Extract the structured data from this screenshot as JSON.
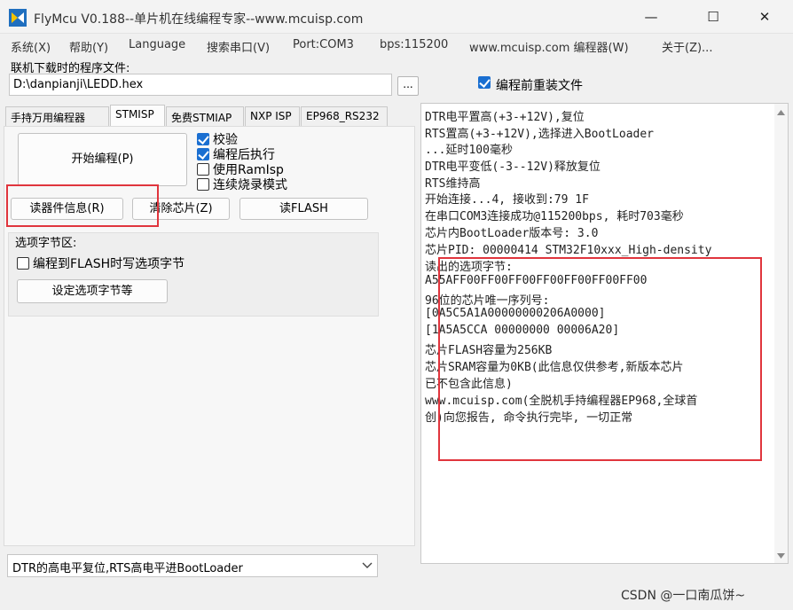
{
  "window": {
    "title": "FlyMcu V0.188--单片机在线编程专家--www.mcuisp.com",
    "minimize_glyph": "—",
    "maximize_glyph": "☐",
    "close_glyph": "✕"
  },
  "menu": [
    "系统(X)",
    "帮助(Y)",
    "Language",
    "搜索串口(V)",
    "Port:COM3",
    "bps:115200",
    "www.mcuisp.com 编程器(W)",
    "关于(Z)..."
  ],
  "file": {
    "label": "联机下载时的程序文件:",
    "path": "D:\\danpianji\\LEDD.hex",
    "browse_label": "...",
    "reload_label": "编程前重装文件",
    "reload_checked": true
  },
  "tabs": [
    "手持万用编程器",
    "STMISP",
    "免费STMIAP",
    "NXP ISP",
    "EP968_RS232"
  ],
  "active_tab": "STMISP",
  "actions": {
    "start_program": "开始编程(P)",
    "read_info": "读器件信息(R)",
    "erase_chip": "清除芯片(Z)",
    "read_flash": "读FLASH"
  },
  "options": {
    "verify": "校验",
    "run_after": "编程后执行",
    "use_ramisp": "使用RamIsp",
    "continuous": "连续烧录模式"
  },
  "option_bytes": {
    "group_label": "选项字节区:",
    "write_on_flash": "编程到FLASH时写选项字节",
    "set_button": "设定选项字节等"
  },
  "boot_mode": "DTR的高电平复位,RTS高电平进BootLoader",
  "log_lines": [
    "DTR电平置高(+3-+12V),复位",
    "RTS置高(+3-+12V),选择进入BootLoader",
    "...延时100毫秒",
    "DTR电平变低(-3--12V)释放复位",
    "RTS维持高",
    "开始连接...4, 接收到:79 1F",
    "在串口COM3连接成功@115200bps, 耗时703毫秒",
    "芯片内BootLoader版本号: 3.0",
    "芯片PID: 00000414  STM32F10xxx_High-density",
    "读出的选项字节:",
    "A55AFF00FF00FF00FF00FF00FF00FF00",
    "96位的芯片唯一序列号:",
    "[0A5C5A1A00000000206A0000]",
    "[1A5A5CCA 00000000 00006A20]",
    "芯片FLASH容量为256KB",
    "芯片SRAM容量为0KB(此信息仅供参考,新版本芯片",
    "已不包含此信息)",
    "www.mcuisp.com(全脱机手持编程器EP968,全球首",
    "创)向您报告, 命令执行完毕, 一切正常"
  ],
  "watermark": "CSDN @一口南瓜饼~",
  "colors": {
    "highlight": "#e0353d",
    "checkbox": "#1a6fd1"
  },
  "icons": {
    "app": "flymcu-logo-icon",
    "dropdown": "chevron-down-icon"
  }
}
